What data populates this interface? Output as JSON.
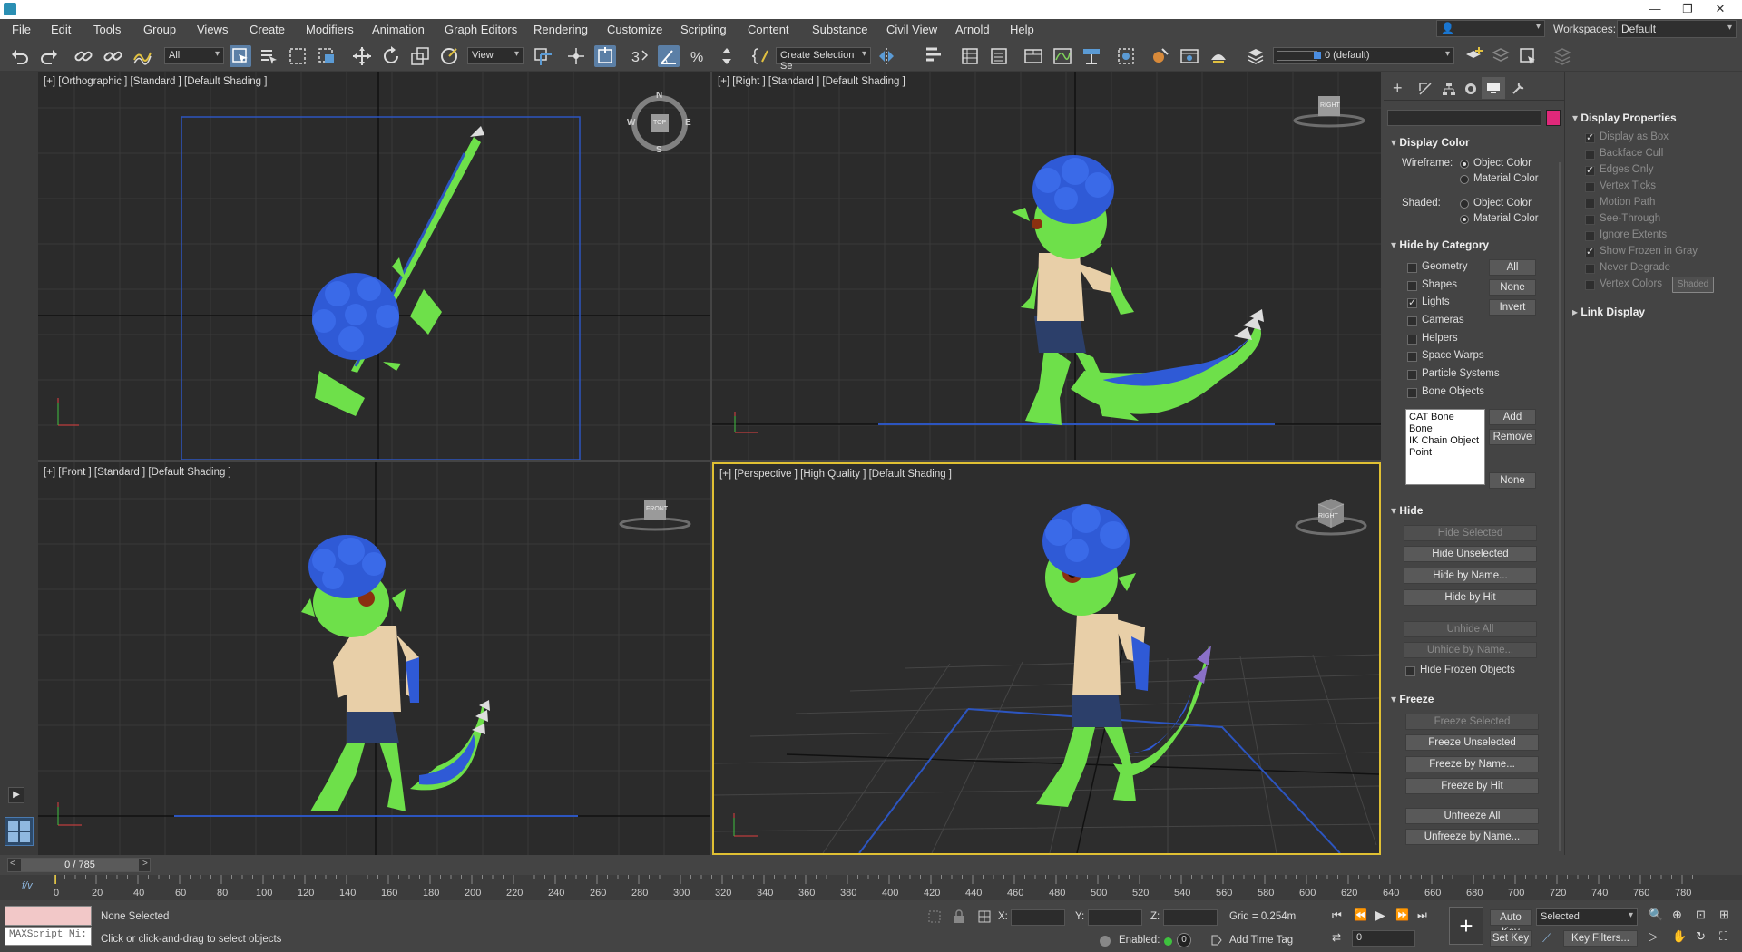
{
  "menu": [
    "File",
    "Edit",
    "Tools",
    "Group",
    "Views",
    "Create",
    "Modifiers",
    "Animation",
    "Graph Editors",
    "Rendering",
    "Customize",
    "Scripting",
    "Content",
    "Substance",
    "Civil View",
    "Arnold",
    "Help"
  ],
  "workspaces": {
    "label": "Workspaces:",
    "value": "Default"
  },
  "toolbar": {
    "filter": "All",
    "refcoord": "View",
    "selection_set": "Create Selection Se",
    "layer": "0 (default)"
  },
  "viewports": [
    {
      "label": "[+] [Orthographic ] [Standard ] [Default Shading ]"
    },
    {
      "label": "[+] [Right ] [Standard ] [Default Shading ]",
      "cube": "RIGHT"
    },
    {
      "label": "[+] [Front ] [Standard ] [Default Shading ]",
      "cube": "FRONT"
    },
    {
      "label": "[+] [Perspective ] [High Quality ] [Default Shading ]",
      "cube": "RIGHT"
    }
  ],
  "compass": {
    "n": "N",
    "s": "S",
    "e": "E",
    "w": "W",
    "top": "TOP"
  },
  "panel": {
    "display_color": {
      "title": "Display Color",
      "wireframe": "Wireframe:",
      "shaded": "Shaded:",
      "object_color": "Object Color",
      "material_color": "Material Color"
    },
    "hide_by_category": {
      "title": "Hide by Category",
      "items": [
        {
          "label": "Geometry",
          "checked": false
        },
        {
          "label": "Shapes",
          "checked": false
        },
        {
          "label": "Lights",
          "checked": true
        },
        {
          "label": "Cameras",
          "checked": false
        },
        {
          "label": "Helpers",
          "checked": false
        },
        {
          "label": "Space Warps",
          "checked": false
        },
        {
          "label": "Particle Systems",
          "checked": false
        },
        {
          "label": "Bone Objects",
          "checked": false
        }
      ],
      "all": "All",
      "none": "None",
      "invert": "Invert",
      "list": [
        "CAT Bone",
        "Bone",
        "IK Chain Object",
        "Point"
      ],
      "add": "Add",
      "remove": "Remove",
      "none2": "None"
    },
    "hide": {
      "title": "Hide",
      "hide_selected": "Hide Selected",
      "hide_unselected": "Hide Unselected",
      "hide_by_name": "Hide by Name...",
      "hide_by_hit": "Hide by Hit",
      "unhide_all": "Unhide All",
      "unhide_by_name": "Unhide by Name...",
      "hide_frozen": "Hide Frozen Objects"
    },
    "freeze": {
      "title": "Freeze",
      "freeze_selected": "Freeze Selected",
      "freeze_unselected": "Freeze Unselected",
      "freeze_by_name": "Freeze by Name...",
      "freeze_by_hit": "Freeze by Hit",
      "unfreeze_all": "Unfreeze All",
      "unfreeze_by_name": "Unfreeze by Name..."
    }
  },
  "display_properties": {
    "title": "Display Properties",
    "items": [
      {
        "label": "Display as Box",
        "checked": true
      },
      {
        "label": "Backface Cull",
        "checked": false
      },
      {
        "label": "Edges Only",
        "checked": true
      },
      {
        "label": "Vertex Ticks",
        "checked": false
      },
      {
        "label": "Motion Path",
        "checked": false
      },
      {
        "label": "See-Through",
        "checked": false
      },
      {
        "label": "Ignore Extents",
        "checked": false
      },
      {
        "label": "Show Frozen in Gray",
        "checked": true
      },
      {
        "label": "Never Degrade",
        "checked": false
      },
      {
        "label": "Vertex Colors",
        "checked": false
      }
    ],
    "shaded": "Shaded",
    "link_display": "Link Display"
  },
  "time": {
    "frame": "0 / 785",
    "ticks": [
      "0",
      "20",
      "40",
      "60",
      "80",
      "100",
      "120",
      "140",
      "160",
      "180",
      "200",
      "220",
      "240",
      "260",
      "280",
      "300",
      "320",
      "340",
      "360",
      "380",
      "400",
      "420",
      "440",
      "460",
      "480",
      "500",
      "520",
      "540",
      "560",
      "580",
      "600",
      "620",
      "640",
      "660",
      "680",
      "700",
      "720",
      "740",
      "760",
      "780"
    ]
  },
  "status": {
    "maxscript": "MAXScript Mi:",
    "selection": "None Selected",
    "prompt": "Click or click-and-drag to select objects",
    "x": "X:",
    "y": "Y:",
    "z": "Z:",
    "grid": "Grid = 0.254m",
    "enabled": "Enabled:",
    "add_time_tag": "Add Time Tag",
    "auto_key": "Auto Key",
    "selected": "Selected",
    "set_key": "Set Key",
    "key_filters": "Key Filters...",
    "frame_field": "0"
  },
  "colors": {
    "accent": "#e0c033",
    "selection_blue": "#5b7fa6",
    "character_green": "#79e65a",
    "hair_blue": "#2f5ad6",
    "swatch": "#e0287a"
  }
}
